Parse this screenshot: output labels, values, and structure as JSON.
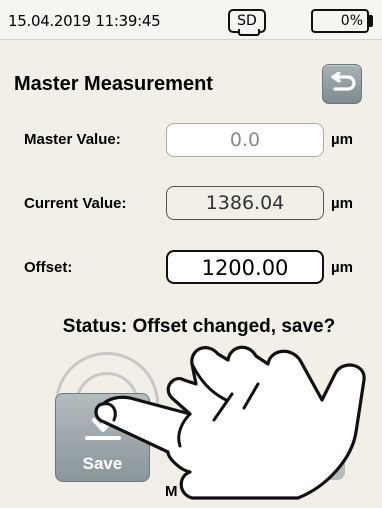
{
  "status_bar": {
    "datetime": "15.04.2019 11:39:45",
    "sd_label": "SD",
    "battery_label": "0%"
  },
  "header": {
    "title": "Master Measurement",
    "back_icon": "back-arrow-icon"
  },
  "fields": {
    "master": {
      "label": "Master Value:",
      "value": "0.0",
      "unit": "µm"
    },
    "current": {
      "label": "Current Value:",
      "value": "1386.04",
      "unit": "µm"
    },
    "offset": {
      "label": "Offset:",
      "value": "1200.00",
      "unit": "µm"
    }
  },
  "status": {
    "text": "Status: Offset changed, save?"
  },
  "actions": {
    "save_label": "Save",
    "save_icon": "download-arrow-icon",
    "bottom_partial_label": "M"
  },
  "overlay": {
    "hand_icon": "pointing-hand-icon"
  },
  "colors": {
    "background": "#f2efe9",
    "button": "#8b969a",
    "text": "#000000"
  }
}
